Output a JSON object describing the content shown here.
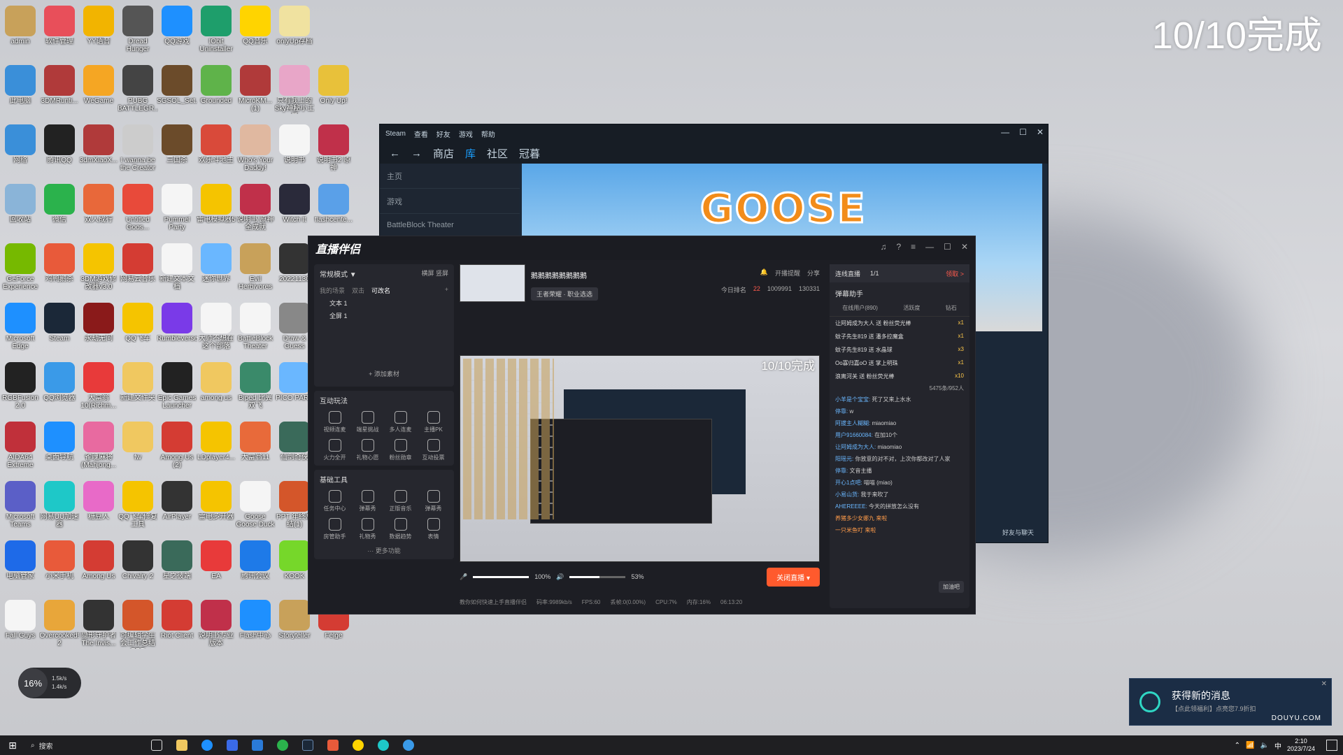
{
  "desktop": {
    "overlay_title": "10/10完成",
    "icons": [
      {
        "label": "admin",
        "color": "#c8a15a",
        "col": 0,
        "row": 0
      },
      {
        "label": "软件管理",
        "color": "#e84f5a",
        "col": 1,
        "row": 0
      },
      {
        "label": "YY语音",
        "color": "#f2b400",
        "col": 2,
        "row": 0
      },
      {
        "label": "Dread Hunger",
        "color": "#555",
        "col": 3,
        "row": 0
      },
      {
        "label": "QQ游戏",
        "color": "#1e90ff",
        "col": 4,
        "row": 0
      },
      {
        "label": "IObit Uninstaller",
        "color": "#1e9e6b",
        "col": 5,
        "row": 0
      },
      {
        "label": "QQ音乐",
        "color": "#ffd400",
        "col": 6,
        "row": 0
      },
      {
        "label": "onlyUp存档",
        "color": "#f0e2a0",
        "col": 7,
        "row": 0
      },
      {
        "label": "此电脑",
        "color": "#3a8fd9",
        "col": 0,
        "row": 1
      },
      {
        "label": "3DMRunti...",
        "color": "#b03a3a",
        "col": 1,
        "row": 1
      },
      {
        "label": "WeGame",
        "color": "#f5a623",
        "col": 2,
        "row": 1
      },
      {
        "label": "PUBG BATTLEGR...",
        "color": "#444",
        "col": 3,
        "row": 1
      },
      {
        "label": "SGSOL_Set...",
        "color": "#6b4b2a",
        "col": 4,
        "row": 1
      },
      {
        "label": "Grounded",
        "color": "#5fb34a",
        "col": 5,
        "row": 1
      },
      {
        "label": "MicroKM... (1)",
        "color": "#b03a3a",
        "col": 6,
        "row": 1
      },
      {
        "label": "只有我上的Sky神秘小工具",
        "color": "#e8a6c8",
        "col": 7,
        "row": 1
      },
      {
        "label": "Only Up!",
        "color": "#e8c13a",
        "col": 8,
        "row": 1
      },
      {
        "label": "网络",
        "color": "#3a8fd9",
        "col": 0,
        "row": 2
      },
      {
        "label": "腾讯QQ",
        "color": "#222",
        "col": 1,
        "row": 2
      },
      {
        "label": "3dmXiaoX...",
        "color": "#b03a3a",
        "col": 2,
        "row": 2
      },
      {
        "label": "I wanna be the Creator",
        "color": "#ccc",
        "col": 3,
        "row": 2
      },
      {
        "label": "三国杀",
        "color": "#6b4b2a",
        "col": 4,
        "row": 2
      },
      {
        "label": "欢乐斗地主",
        "color": "#d94a3a",
        "col": 5,
        "row": 2
      },
      {
        "label": "Who's Your Daddy!",
        "color": "#e0b8a0",
        "col": 6,
        "row": 2
      },
      {
        "label": "说明书",
        "color": "#f5f5f5",
        "col": 7,
        "row": 2
      },
      {
        "label": "说明书2 原神",
        "color": "#c0304a",
        "col": 8,
        "row": 2
      },
      {
        "label": "回收站",
        "color": "#8ab4d8",
        "col": 0,
        "row": 3
      },
      {
        "label": "微信",
        "color": "#2bb24c",
        "col": 1,
        "row": 3
      },
      {
        "label": "双人成行",
        "color": "#e8683a",
        "col": 2,
        "row": 3
      },
      {
        "label": "Untitled Goos...",
        "color": "#e84a3a",
        "col": 3,
        "row": 3
      },
      {
        "label": "Pummel Party",
        "color": "#f5f5f5",
        "col": 4,
        "row": 3
      },
      {
        "label": "雷电模拟器5",
        "color": "#f5c400",
        "col": 5,
        "row": 3
      },
      {
        "label": "说明书 原神全成就",
        "color": "#c0304a",
        "col": 6,
        "row": 3
      },
      {
        "label": "Witch It",
        "color": "#2a2a3a",
        "col": 7,
        "row": 3
      },
      {
        "label": "flashcente...",
        "color": "#5aa0e8",
        "col": 8,
        "row": 3
      },
      {
        "label": "GeForce Experience",
        "color": "#76b900",
        "col": 0,
        "row": 4
      },
      {
        "label": "鸡鸭鹅杀",
        "color": "#e85a3a",
        "col": 1,
        "row": 4
      },
      {
        "label": "3DM游戏修改器v3.0",
        "color": "#f5c400",
        "col": 2,
        "row": 4
      },
      {
        "label": "网易云音乐",
        "color": "#d43c33",
        "col": 3,
        "row": 4
      },
      {
        "label": "新建文本文档",
        "color": "#f5f5f5",
        "col": 4,
        "row": 4
      },
      {
        "label": "迷你世界",
        "color": "#6ab7ff",
        "col": 5,
        "row": 4
      },
      {
        "label": "Evil Herbivores",
        "color": "#c8a15a",
        "col": 6,
        "row": 4
      },
      {
        "label": "20221130",
        "color": "#333",
        "col": 7,
        "row": 4
      },
      {
        "label": "Microsoft Edge",
        "color": "#1e90ff",
        "col": 0,
        "row": 5
      },
      {
        "label": "Steam",
        "color": "#1b2838",
        "col": 1,
        "row": 5
      },
      {
        "label": "永劫无间",
        "color": "#8a1a1a",
        "col": 2,
        "row": 5
      },
      {
        "label": "QQ飞车",
        "color": "#f5c400",
        "col": 3,
        "row": 5
      },
      {
        "label": "Rumbleverse",
        "color": "#7a3ae8",
        "col": 4,
        "row": 5
      },
      {
        "label": "大师不想在这个部落",
        "color": "#f5f5f5",
        "col": 5,
        "row": 5
      },
      {
        "label": "BattleBlock Theater",
        "color": "#f5f5f5",
        "col": 6,
        "row": 5
      },
      {
        "label": "Draw & Guess",
        "color": "#888",
        "col": 7,
        "row": 5
      },
      {
        "label": "RGBFusion 2.0",
        "color": "#222",
        "col": 0,
        "row": 6
      },
      {
        "label": "QQ浏览器",
        "color": "#3a9ae8",
        "col": 1,
        "row": 6
      },
      {
        "label": "大富翁10(Richm...",
        "color": "#e83a3a",
        "col": 2,
        "row": 6
      },
      {
        "label": "新建文件夹",
        "color": "#f0c860",
        "col": 3,
        "row": 6
      },
      {
        "label": "Epic Games Launcher",
        "color": "#222",
        "col": 4,
        "row": 6
      },
      {
        "label": "among us",
        "color": "#f0c860",
        "col": 5,
        "row": 6
      },
      {
        "label": "Biped 比翼双飞",
        "color": "#3a8a6a",
        "col": 6,
        "row": 6
      },
      {
        "label": "PICO PARK",
        "color": "#6ab7ff",
        "col": 7,
        "row": 6
      },
      {
        "label": "AIDA64 Extreme",
        "color": "#c0303a",
        "col": 0,
        "row": 7
      },
      {
        "label": "桌面导航",
        "color": "#1e90ff",
        "col": 1,
        "row": 7
      },
      {
        "label": "雀魂麻将(Mahjong...",
        "color": "#e86aa0",
        "col": 2,
        "row": 7
      },
      {
        "label": "fw",
        "color": "#f0c860",
        "col": 3,
        "row": 7
      },
      {
        "label": "Among Us (2)",
        "color": "#d43c33",
        "col": 4,
        "row": 7
      },
      {
        "label": "LDplayer4...",
        "color": "#f5c400",
        "col": 5,
        "row": 7
      },
      {
        "label": "大富翁11",
        "color": "#e86a3a",
        "col": 6,
        "row": 7
      },
      {
        "label": "仙剑奇侠",
        "color": "#3a6a5a",
        "col": 7,
        "row": 7
      },
      {
        "label": "Microsoft Teams",
        "color": "#5b5fc7",
        "col": 0,
        "row": 8
      },
      {
        "label": "网易UU加速器",
        "color": "#1ec8c8",
        "col": 1,
        "row": 8
      },
      {
        "label": "糖豆人",
        "color": "#e86ac8",
        "col": 2,
        "row": 8
      },
      {
        "label": "QQ飞车修复工具",
        "color": "#f5c400",
        "col": 3,
        "row": 8
      },
      {
        "label": "AirPlayer",
        "color": "#333",
        "col": 4,
        "row": 8
      },
      {
        "label": "雷电多开器",
        "color": "#f5c400",
        "col": 5,
        "row": 8
      },
      {
        "label": "Goose Goose Duck",
        "color": "#f5f5f5",
        "col": 6,
        "row": 8
      },
      {
        "label": "PPT 年终总结(1)",
        "color": "#d4562a",
        "col": 7,
        "row": 8
      },
      {
        "label": "电脑管家",
        "color": "#1e6ae8",
        "col": 0,
        "row": 9
      },
      {
        "label": "小米手机",
        "color": "#e85a3a",
        "col": 1,
        "row": 9
      },
      {
        "label": "Among Us",
        "color": "#d43c33",
        "col": 2,
        "row": 9
      },
      {
        "label": "Chivalry 2",
        "color": "#333",
        "col": 3,
        "row": 9
      },
      {
        "label": "星之彼端",
        "color": "#3a6a5a",
        "col": 4,
        "row": 9
      },
      {
        "label": "EA",
        "color": "#e83a3a",
        "col": 5,
        "row": 9
      },
      {
        "label": "腾讯会议",
        "color": "#1e7ae8",
        "col": 6,
        "row": 9
      },
      {
        "label": "KOOK",
        "color": "#76d72a",
        "col": 7,
        "row": 9
      },
      {
        "label": "Fall Guys",
        "color": "#f5f5f5",
        "col": 0,
        "row": 10
      },
      {
        "label": "Overcooked! 2",
        "color": "#e8a63a",
        "col": 1,
        "row": 10
      },
      {
        "label": "隐形守护者 The Invis...",
        "color": "#333",
        "col": 2,
        "row": 10
      },
      {
        "label": "可编辑学生会工作总结PPT",
        "color": "#d4562a",
        "col": 3,
        "row": 10
      },
      {
        "label": "Riot Client",
        "color": "#d43c33",
        "col": 4,
        "row": 10
      },
      {
        "label": "说明书专业版本",
        "color": "#c0304a",
        "col": 5,
        "row": 10
      },
      {
        "label": "Flash中心",
        "color": "#1e90ff",
        "col": 6,
        "row": 10
      },
      {
        "label": "Storyteller",
        "color": "#c8a15a",
        "col": 7,
        "row": 10
      },
      {
        "label": "Felge",
        "color": "#d43c33",
        "col": 8,
        "row": 10
      }
    ]
  },
  "steam": {
    "menu": [
      "Steam",
      "查看",
      "好友",
      "游戏",
      "帮助"
    ],
    "nav": [
      "商店",
      "库",
      "社区",
      "冠暮"
    ],
    "active_nav": "库",
    "side_home": "主页",
    "side_games": "游戏",
    "side_item": "BattleBlock Theater",
    "banner_text": "GOOSE GOOSE",
    "friends_chat": "好友与聊天"
  },
  "live": {
    "app_title": "直播伴侣",
    "mode": "常规模式 ▼",
    "mode_right": [
      "横屏",
      "竖屏"
    ],
    "scene_tabs": [
      "我的场景",
      "双击",
      "可改名"
    ],
    "scenes": [
      "文本 1",
      "全屏 1"
    ],
    "add_source": "+ 添加素材",
    "section_interactive": "互动玩法",
    "interactive_tools": [
      "视频连麦",
      "端星挑战",
      "多人连麦",
      "主播PK",
      "火力全开",
      "礼物心愿",
      "粉丝勋章",
      "互动投票"
    ],
    "section_basic": "基础工具",
    "basic_tools": [
      "任务中心",
      "弹幕秀",
      "正版音乐",
      "弹幕秀",
      "房管助手",
      "礼物秀",
      "数据趋势",
      "表情"
    ],
    "more_features": "··· 更多功能",
    "stream_name": "鹅鹅鹅鹅鹅鹅鹅鹅",
    "category": "王者荣耀 · 职业选选",
    "actions": [
      "开播提醒",
      "分享"
    ],
    "stats": {
      "rank_label": "今日排名",
      "rank": "22",
      "hot": "1009991",
      "likes": "130331"
    },
    "preview_title": "10/10完成",
    "mic_level": "100%",
    "speaker_level": "53%",
    "mic_fill": 1.0,
    "speaker_fill": 0.53,
    "close_button": "关闭直播 ▾",
    "status": [
      "教你如何快速上手直播伴侣",
      "码率:9989kb/s",
      "FPS:60",
      "丢帧:0(0.00%)",
      "CPU:7%",
      "内存:16%",
      "06:13:20"
    ],
    "connect_title": "连线直播",
    "connect_count": "1/1",
    "connect_right": "领取 >",
    "assistant_title": "弹幕助手",
    "assistant_tabs": [
      "在线用户(890)",
      "活跃度",
      "钻石"
    ],
    "gifts": [
      {
        "text": "让阿姆成为大人 送 粉丝荧光棒",
        "amount": "x1"
      },
      {
        "text": "蚊子先生819 送 潘多拉魔盒",
        "amount": "x1"
      },
      {
        "text": "蚊子先生819 送 水晶球",
        "amount": "x3"
      },
      {
        "text": "Oo寡归嘉oO 送 掌上明珠",
        "amount": "x1"
      },
      {
        "text": "浪离河关 送 粉丝荧光棒",
        "amount": "x10"
      }
    ],
    "chats": [
      {
        "user": "小羊是个宝宝:",
        "msg": "死了又来上水水"
      },
      {
        "user": "停靠:",
        "msg": "w"
      },
      {
        "user": "阿拔主人糊糊:",
        "msg": "miaomiao"
      },
      {
        "user": "用户91660084:",
        "msg": "在加10个"
      },
      {
        "user": "让阿姆成为大人:",
        "msg": "miaomiao"
      },
      {
        "user": "阳瑶元:",
        "msg": "你放意的对不对，上次你都改对了人家"
      },
      {
        "user": "停靠:",
        "msg": "文音主播"
      },
      {
        "user": "开心1点吧:",
        "msg": "喵喵 (miao)"
      },
      {
        "user": "小易山货:",
        "msg": "我于来吹了"
      },
      {
        "user": "AHEREEEE:",
        "msg": "今天的拼放怎么没有"
      }
    ],
    "online_badge": "5475条/952人",
    "entries": [
      "养猪多少女娜九 来啦",
      "一只米鱼叮 来啦"
    ],
    "entry_button": "加油吧"
  },
  "taskbar": {
    "search": "搜索",
    "time": "2:10",
    "date": "2023/7/24"
  },
  "net": {
    "percent": "16%",
    "up": "1.5k/s",
    "down": "1.4k/s"
  },
  "notification": {
    "title": "获得新的消息",
    "sub": "【点此领福利】点亮您7.9折扣",
    "brand": "DOUYU.COM"
  }
}
